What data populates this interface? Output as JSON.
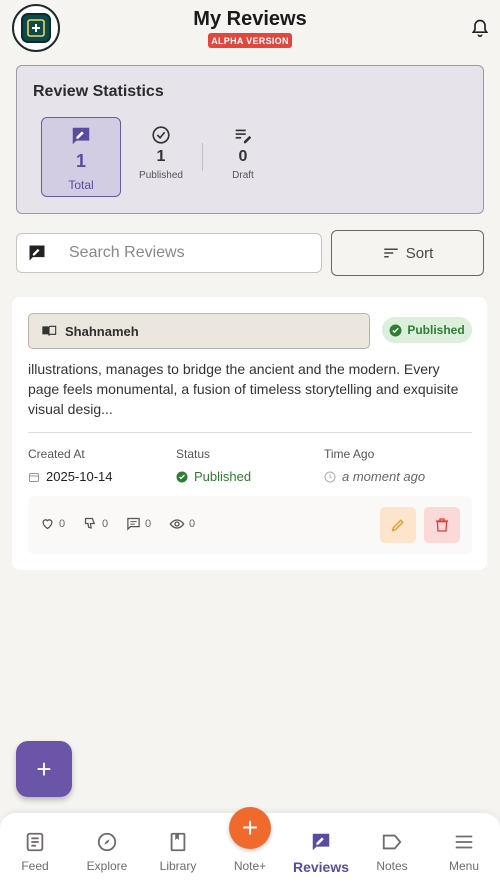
{
  "header": {
    "title": "My Reviews",
    "badge": "ALPHA VERSION",
    "logo_icon": "book-plus-icon",
    "bell_icon": "bell-icon"
  },
  "stats": {
    "title": "Review Statistics",
    "items": [
      {
        "icon": "rate-review-icon",
        "value": "1",
        "label": "Total"
      },
      {
        "icon": "check-circle-icon",
        "value": "1",
        "label": "Published"
      },
      {
        "icon": "edit-note-icon",
        "value": "0",
        "label": "Draft"
      }
    ]
  },
  "search": {
    "placeholder": "Search Reviews",
    "value": ""
  },
  "sort": {
    "label": "Sort"
  },
  "review": {
    "book": "Shahnameh",
    "status_badge": "Published",
    "excerpt": "illustrations, manages to bridge the ancient and the modern. Every page feels monumental, a fusion of timeless storytelling and exquisite visual desig...",
    "meta": {
      "created_label": "Created At",
      "created_value": "2025-10-14",
      "status_label": "Status",
      "status_value": "Published",
      "time_label": "Time Ago",
      "time_value": "a moment ago"
    },
    "actions": {
      "likes": "0",
      "dislikes": "0",
      "comments": "0",
      "views": "0"
    }
  },
  "fab": {
    "label": "+"
  },
  "nav": {
    "feed": "Feed",
    "explore": "Explore",
    "library": "Library",
    "note_plus": "Note+",
    "reviews": "Reviews",
    "notes": "Notes",
    "menu": "Menu"
  },
  "colors": {
    "accent": "#6b55a8",
    "orange": "#f06a2e",
    "published_green": "#2e7d32",
    "alpha_red": "#e1463f"
  }
}
